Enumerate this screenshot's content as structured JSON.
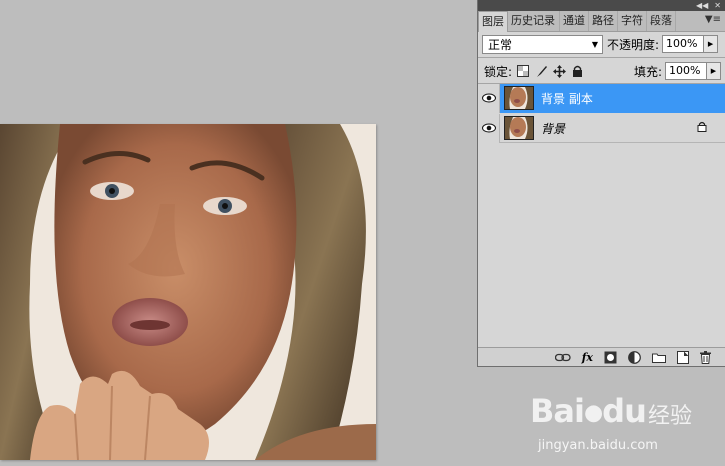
{
  "panel": {
    "tabs": [
      {
        "label": "图层"
      },
      {
        "label": "历史记录"
      },
      {
        "label": "通道"
      },
      {
        "label": "路径"
      },
      {
        "label": "字符"
      },
      {
        "label": "段落"
      }
    ],
    "blend_mode": "正常",
    "opacity_label": "不透明度:",
    "opacity_value": "100%",
    "lock_label": "锁定:",
    "fill_label": "填充:",
    "fill_value": "100%",
    "layers": [
      {
        "name": "背景 副本",
        "visible": true,
        "selected": true,
        "locked": false
      },
      {
        "name": "背景",
        "visible": true,
        "selected": false,
        "locked": true
      }
    ],
    "bottom_icons": [
      "link-icon",
      "fx-icon",
      "mask-icon",
      "adjustment-icon",
      "folder-icon",
      "new-layer-icon",
      "trash-icon"
    ],
    "fx_label": "fx"
  },
  "watermark": {
    "brand": "Bai",
    "brand_suffix": "du",
    "cn": "经验",
    "url": "jingyan.baidu.com"
  },
  "colors": {
    "selection": "#3b97f5",
    "background": "#bdbdbd",
    "panel": "#d6d6d6"
  }
}
